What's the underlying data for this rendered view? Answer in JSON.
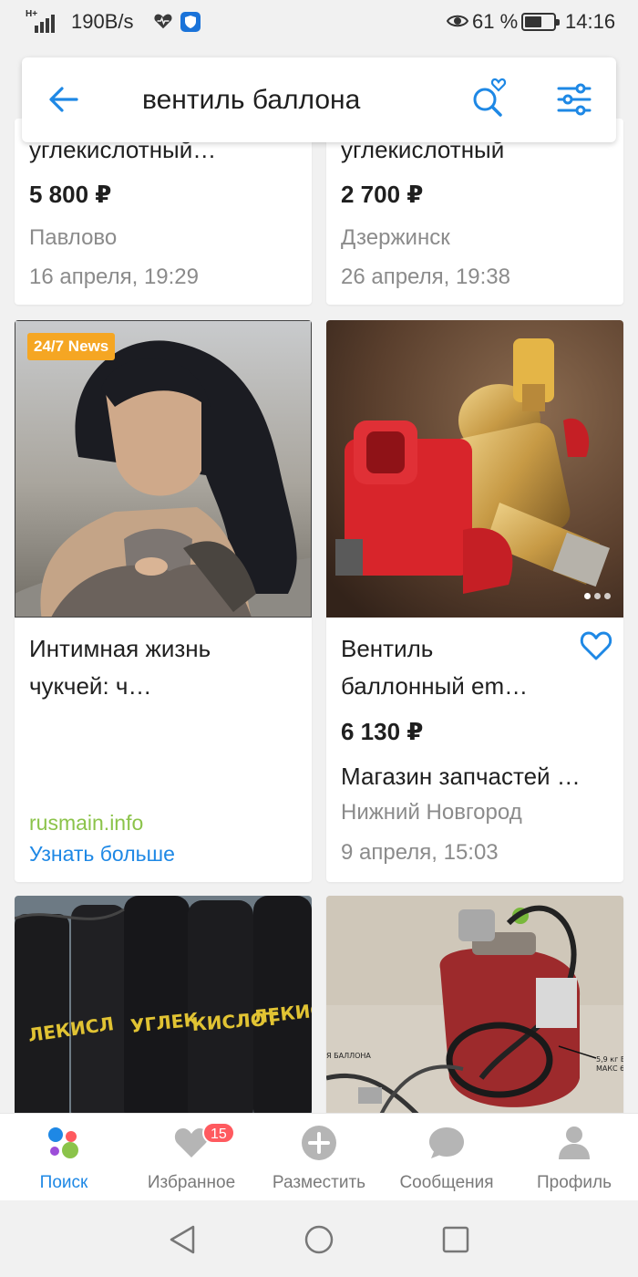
{
  "status_bar": {
    "network": "H+",
    "speed": "190B/s",
    "battery_percent": "61 %",
    "battery_level": 0.61,
    "time": "14:16"
  },
  "search": {
    "query": "вентиль баллона"
  },
  "listings": [
    {
      "title": "углекислотный…",
      "price": "5 800 ₽",
      "location": "Павлово",
      "date": "16 апреля, 19:29"
    },
    {
      "title": "углекислотный",
      "price": "2 700 ₽",
      "location": "Дзержинск",
      "date": "26 апреля, 19:38"
    },
    {
      "badge": "24/7 News",
      "title_line1": "Интимная жизнь",
      "title_line2": "чукчей: ч…",
      "source": "rusmain.info",
      "cta": "Узнать больше"
    },
    {
      "title_line1": "Вентиль",
      "title_line2": "баллонный em…",
      "price": "6 130 ₽",
      "seller": "Магазин запчастей …",
      "location": "Нижний Новгород",
      "date": "9 апреля, 15:03"
    }
  ],
  "bottom_nav": [
    {
      "label": "Поиск",
      "icon": "search-dots-icon",
      "active": true
    },
    {
      "label": "Избранное",
      "icon": "heart-icon",
      "badge": "15"
    },
    {
      "label": "Разместить",
      "icon": "plus-circle-icon"
    },
    {
      "label": "Сообщения",
      "icon": "chat-bubble-icon"
    },
    {
      "label": "Профиль",
      "icon": "profile-icon"
    }
  ],
  "colors": {
    "accent": "#1e88e5",
    "ad_source": "#8bc34a",
    "badge": "#f5a623",
    "notification": "#ff5a5f"
  }
}
